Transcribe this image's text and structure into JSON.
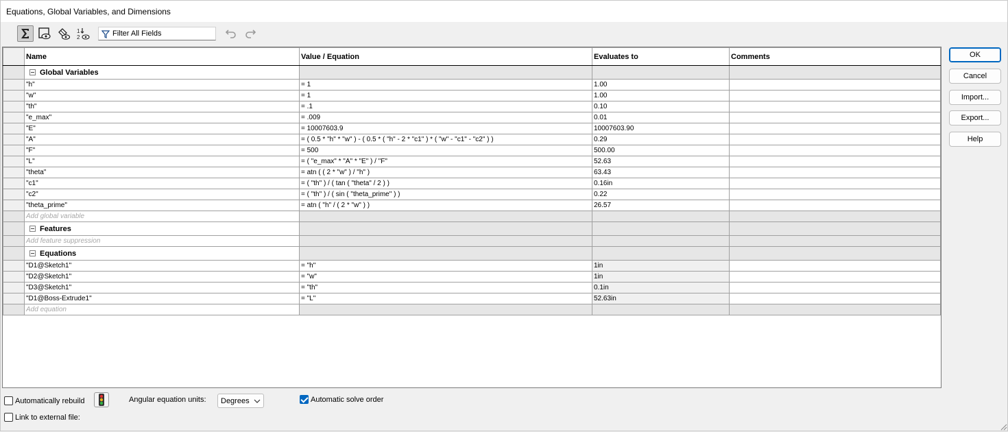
{
  "window": {
    "title": "Equations, Global Variables, and Dimensions"
  },
  "toolbar": {
    "filter_placeholder": "Filter All Fields",
    "buttons": [
      "equation-view-icon",
      "sketch-equation-view-icon",
      "dimension-view-icon",
      "ordered-view-icon"
    ]
  },
  "columns": {
    "name": "Name",
    "value": "Value / Equation",
    "evaluates": "Evaluates to",
    "comments": "Comments"
  },
  "global_section": {
    "title": "Global Variables",
    "add_placeholder": "Add global variable",
    "rows": [
      {
        "name": "\"h\"",
        "value": "= 1",
        "evaluates": "1.00"
      },
      {
        "name": "\"w\"",
        "value": "= 1",
        "evaluates": "1.00"
      },
      {
        "name": "\"th\"",
        "value": "= .1",
        "evaluates": "0.10"
      },
      {
        "name": "\"e_max\"",
        "value": "= .009",
        "evaluates": "0.01"
      },
      {
        "name": "\"E\"",
        "value": "= 10007603.9",
        "evaluates": "10007603.90"
      },
      {
        "name": "\"A\"",
        "value": "= ( 0.5 * \"h\" * \"w\" ) - ( 0.5 * ( \"h\" - 2 * \"c1\" ) * ( \"w\" - \"c1\" - \"c2\" ) )",
        "evaluates": "0.29"
      },
      {
        "name": "\"F\"",
        "value": "= 500",
        "evaluates": "500.00"
      },
      {
        "name": "\"L\"",
        "value": "= ( \"e_max\" * \"A\" * \"E\" ) / \"F\"",
        "evaluates": "52.63"
      },
      {
        "name": "\"theta\"",
        "value": "= atn ( ( 2 * \"w\" ) / \"h\" )",
        "evaluates": "63.43"
      },
      {
        "name": "\"c1\"",
        "value": "= ( \"th\" ) / ( tan ( \"theta\" / 2 ) )",
        "evaluates": "0.16in"
      },
      {
        "name": "\"c2\"",
        "value": "= ( \"th\" ) / ( sin ( \"theta_prime\" ) )",
        "evaluates": "0.22"
      },
      {
        "name": "\"theta_prime\"",
        "value": "= atn ( \"h\" / ( 2 * \"w\" ) )",
        "evaluates": "26.57"
      }
    ]
  },
  "features_section": {
    "title": "Features",
    "add_placeholder": "Add feature suppression"
  },
  "equations_section": {
    "title": "Equations",
    "add_placeholder": "Add equation",
    "rows": [
      {
        "name": "\"D1@Sketch1\"",
        "value": "= \"h\"",
        "evaluates": "1in"
      },
      {
        "name": "\"D2@Sketch1\"",
        "value": "= \"w\"",
        "evaluates": "1in"
      },
      {
        "name": "\"D3@Sketch1\"",
        "value": "= \"th\"",
        "evaluates": "0.1in"
      },
      {
        "name": "\"D1@Boss-Extrude1\"",
        "value": "= \"L\"",
        "evaluates": "52.63in"
      }
    ]
  },
  "buttons": {
    "ok": "OK",
    "cancel": "Cancel",
    "import": "Import...",
    "export": "Export...",
    "help": "Help"
  },
  "bottom": {
    "auto_rebuild_label": "Automatically rebuild",
    "auto_rebuild_checked": false,
    "angular_units_label": "Angular equation units:",
    "angular_units_value": "Degrees",
    "auto_solve_label": "Automatic solve order",
    "auto_solve_checked": true,
    "link_external_label": "Link to external file:",
    "link_external_checked": false
  }
}
